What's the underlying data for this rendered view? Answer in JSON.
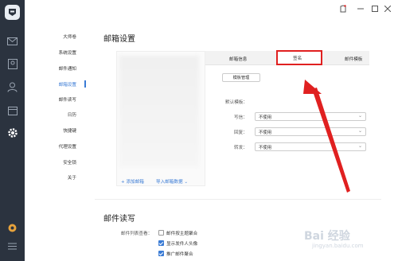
{
  "sidebar": {
    "items": [
      {
        "label": "大师卷"
      },
      {
        "label": "系统设置"
      },
      {
        "label": "邮件通知"
      },
      {
        "label": "邮箱设置"
      },
      {
        "label": "邮件读写"
      },
      {
        "label": "日历"
      },
      {
        "label": "快捷键"
      },
      {
        "label": "代理设置"
      },
      {
        "label": "安全锁"
      },
      {
        "label": "关于"
      }
    ],
    "active_index": 3
  },
  "mailbox": {
    "title": "邮箱设置",
    "add_account": "+ 添加邮箱",
    "import_data": "导入邮箱数据",
    "tabs": [
      {
        "label": "邮箱信息"
      },
      {
        "label": "签名"
      },
      {
        "label": "邮件模板"
      }
    ],
    "active_tab_index": 1,
    "template_button": "模板管理",
    "default_template_label": "默认模板：",
    "rows": [
      {
        "label": "写信：",
        "value": "不使用"
      },
      {
        "label": "回复：",
        "value": "不使用"
      },
      {
        "label": "转发：",
        "value": "不使用"
      }
    ]
  },
  "reading": {
    "title": "邮件读写",
    "list_view_label": "邮件列表查看：",
    "options": [
      {
        "label": "邮件按主题聚合",
        "checked": false
      },
      {
        "label": "显示发件人头像",
        "checked": true
      },
      {
        "label": "推广邮件聚合",
        "checked": true
      }
    ]
  },
  "colors": {
    "accent": "#3a7bd5",
    "highlight": "#e02020",
    "rail": "#2b333f"
  },
  "icons": [
    "mail-icon",
    "contacts-icon",
    "person-icon",
    "calendar-icon",
    "settings-icon",
    "status-icon",
    "menu-icon"
  ]
}
